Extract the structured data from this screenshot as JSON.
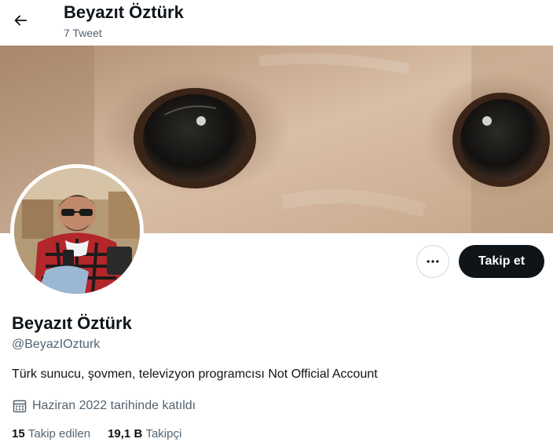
{
  "header": {
    "title": "Beyazıt Öztürk",
    "tweet_count": "7 Tweet",
    "back_icon": "arrow-left-icon"
  },
  "banner": {
    "description_icon": "banner-image"
  },
  "profile": {
    "name": "Beyazıt Öztürk",
    "handle": "@BeyazIOzturk",
    "bio": "Türk sunucu, şovmen, televizyon programcısı Not Official Account",
    "joined": "Haziran 2022 tarihinde katıldı",
    "joined_icon": "calendar-icon"
  },
  "actions": {
    "more_icon": "more-horizontal-icon",
    "follow_label": "Takip et"
  },
  "stats": {
    "following_count": "15",
    "following_label": "Takip edilen",
    "followers_count": "19,1 B",
    "followers_label": "Takipçi"
  },
  "colors": {
    "text_primary": "#0f1419",
    "text_secondary": "#536471",
    "button_dark": "#0f1419",
    "border": "#cfd9de"
  }
}
